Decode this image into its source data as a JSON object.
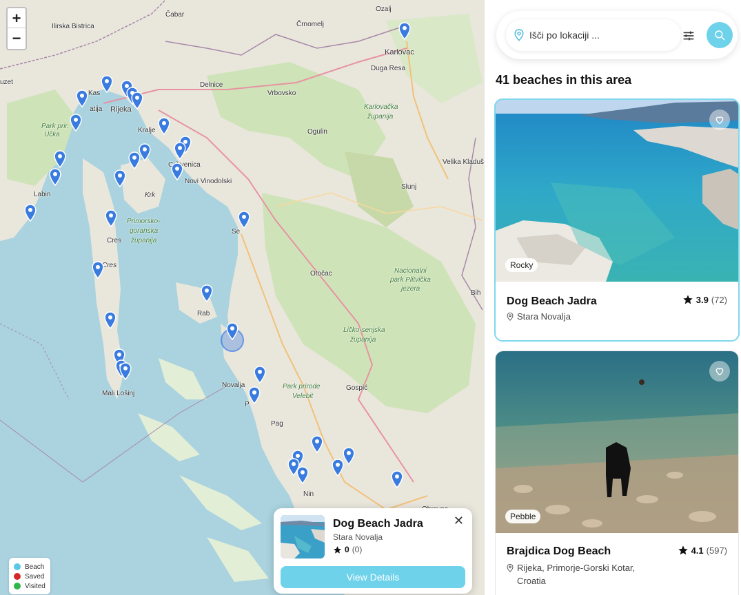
{
  "map": {
    "zoom_in_label": "+",
    "zoom_out_label": "−",
    "labels": {
      "ilirska_bistrica": "Ilirska Bistrica",
      "cabar": "Čabar",
      "crnomelj": "Črnomelj",
      "ozalj": "Ozalj",
      "karlovac": "Karlovac",
      "duga_resa": "Duga Resa",
      "uzet": "uzet",
      "kas": "Kas",
      "rijeka": "Rijeka",
      "atija": "atija",
      "delnice": "Delnice",
      "vrbovsko": "Vrbovsko",
      "karlovacka": "Karlovačka",
      "zupanija1": "županija",
      "park_ucka": "Park prir.",
      "ucka": "Učka",
      "kralje": "Kralje",
      "ogulin": "Ogulin",
      "velika_kladusa": "Velika Kladuš",
      "crikvenica": "Crikvenica",
      "novi_vinodolski": "Novi Vinodolski",
      "labin": "Labin",
      "krk": "Krk",
      "slunj": "Slunj",
      "primorsko": "Primorsko-",
      "goranska": "goranska",
      "zupanija2": "županija",
      "cres": "Cres",
      "se": "Se",
      "cres_island": "Cres",
      "otocac": "Otočac",
      "nacionalni": "Nacionalni",
      "park_plitvicka": "park Plitvička",
      "jezera": "jezera",
      "bih": "Bih",
      "rab": "Rab",
      "licko": "Ličko-senjska",
      "zupanija3": "županija",
      "novalja": "Novalja",
      "park_velebit": "Park prirode",
      "velebit": "Velebit",
      "gospic": "Gospić",
      "mali_losinj": "Mali Lošinj",
      "p": "P",
      "pag": "Pag",
      "nin": "Nin",
      "obrovac": "Obrovac"
    },
    "legend": [
      {
        "label": "Beach",
        "color": "#5bc8e8"
      },
      {
        "label": "Saved",
        "color": "#d62828"
      },
      {
        "label": "Visited",
        "color": "#2fb84a"
      }
    ],
    "pin_color": "#3a7be0"
  },
  "popup": {
    "title": "Dog Beach Jadra",
    "location": "Stara Novalja",
    "rating": "0",
    "reviews": "(0)",
    "button_label": "View Details",
    "close_label": "✕"
  },
  "sidebar": {
    "search_placeholder": "Išči po lokaciji ...",
    "results_title": "41 beaches in this area",
    "accent_color": "#6dd2ea",
    "cards": [
      {
        "title": "Dog Beach Jadra",
        "location": "Stara Novalja",
        "rating": "3.9",
        "reviews": "(72)",
        "tag": "Rocky"
      },
      {
        "title": "Brajdica Dog Beach",
        "location": "Rijeka, Primorje-Gorski Kotar, Croatia",
        "rating": "4.1",
        "reviews": "(597)",
        "tag": "Pebble"
      }
    ]
  }
}
